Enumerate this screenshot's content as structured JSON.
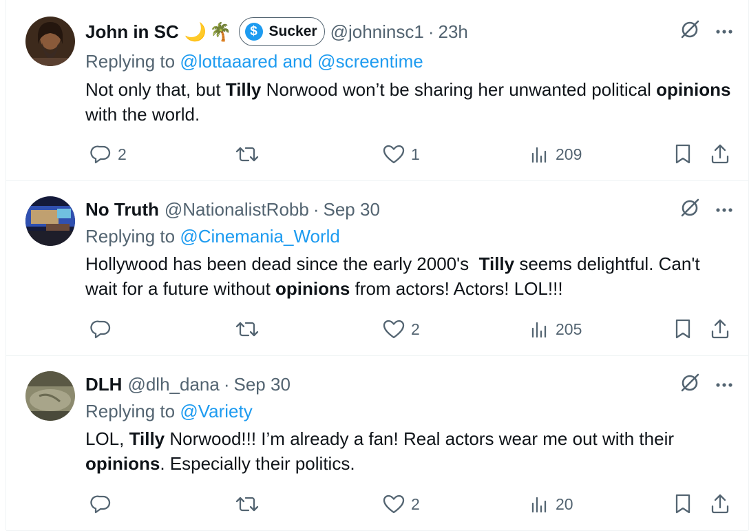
{
  "tweets": [
    {
      "name": "John in SC",
      "emoji": [
        "🌙",
        "🌴"
      ],
      "badge": "Sucker",
      "handle": "@johninsc1",
      "dot": "·",
      "time": "23h",
      "reply_prefix": "Replying to",
      "reply_to": "@lottaaared and @screentime",
      "body": [
        {
          "t": "Not only that, but ",
          "b": false
        },
        {
          "t": "Tilly",
          "b": true
        },
        {
          "t": " Norwood won’t be sharing her unwanted political ",
          "b": false
        },
        {
          "t": "opinions",
          "b": true
        },
        {
          "t": " with the world.",
          "b": false
        }
      ],
      "replies": "2",
      "retweets": "",
      "likes": "1",
      "views": "209",
      "avatar_colors": [
        "#3d2a1c",
        "#8a5a3a"
      ]
    },
    {
      "name": "No Truth",
      "handle": "@NationalistRobb",
      "dot": "·",
      "time": "Sep 30",
      "reply_prefix": "Replying to",
      "reply_to": "@Cinemania_World",
      "body": [
        {
          "t": "Hollywood has been dead since the early 2000's  ",
          "b": false
        },
        {
          "t": "Tilly",
          "b": true
        },
        {
          "t": " seems delightful. Can't wait for a future without ",
          "b": false
        },
        {
          "t": "opinions",
          "b": true
        },
        {
          "t": " from actors! Actors! LOL!!!",
          "b": false
        }
      ],
      "replies": "",
      "retweets": "",
      "likes": "2",
      "views": "205",
      "avatar_colors": [
        "#1a2a6a",
        "#c0a070"
      ]
    },
    {
      "name": "DLH",
      "handle": "@dlh_dana",
      "dot": "·",
      "time": "Sep 30",
      "reply_prefix": "Replying to",
      "reply_to": "@Variety",
      "body": [
        {
          "t": "LOL, ",
          "b": false
        },
        {
          "t": "Tilly",
          "b": true
        },
        {
          "t": " Norwood!!! I’m already a fan! Real actors wear me out with their ",
          "b": false
        },
        {
          "t": "opinions",
          "b": true
        },
        {
          "t": ". Especially their politics.",
          "b": false
        }
      ],
      "replies": "",
      "retweets": "",
      "likes": "2",
      "views": "20",
      "avatar_colors": [
        "#6b6a52",
        "#a8a58a"
      ]
    }
  ],
  "icons": {
    "grok": "grok-icon",
    "more": "more-icon",
    "reply": "reply-icon",
    "retweet": "retweet-icon",
    "like": "like-icon",
    "views": "views-icon",
    "bookmark": "bookmark-icon",
    "share": "share-icon"
  },
  "colors": {
    "link": "#1d9bf0",
    "secondary": "#536471",
    "text": "#0f1419",
    "border": "#eff3f4"
  }
}
